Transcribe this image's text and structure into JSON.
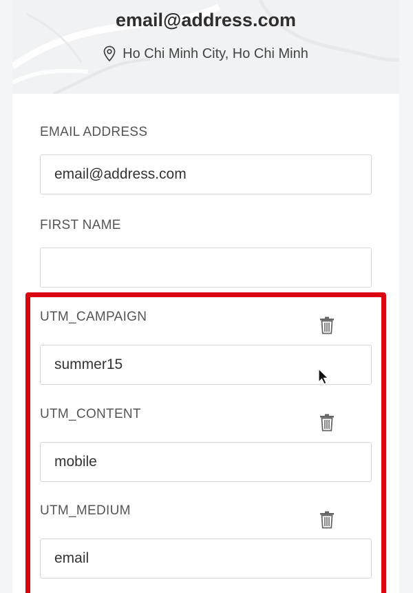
{
  "profile": {
    "email": "email@address.com",
    "location": "Ho Chi Minh City, Ho Chi Minh",
    "location_icon": "map-pin-icon"
  },
  "fields": {
    "email_address": {
      "label": "EMAIL ADDRESS",
      "value": "email@address.com"
    },
    "first_name": {
      "label": "FIRST NAME",
      "value": ""
    },
    "utm_campaign": {
      "label": "UTM_CAMPAIGN",
      "value": "summer15",
      "delete_icon": "trash-icon"
    },
    "utm_content": {
      "label": "UTM_CONTENT",
      "value": "mobile",
      "delete_icon": "trash-icon"
    },
    "utm_medium": {
      "label": "UTM_MEDIUM",
      "value": "email",
      "delete_icon": "trash-icon"
    }
  },
  "colors": {
    "highlight_border": "#d90010",
    "input_border": "#d4d6d9",
    "label_text": "#555555"
  }
}
